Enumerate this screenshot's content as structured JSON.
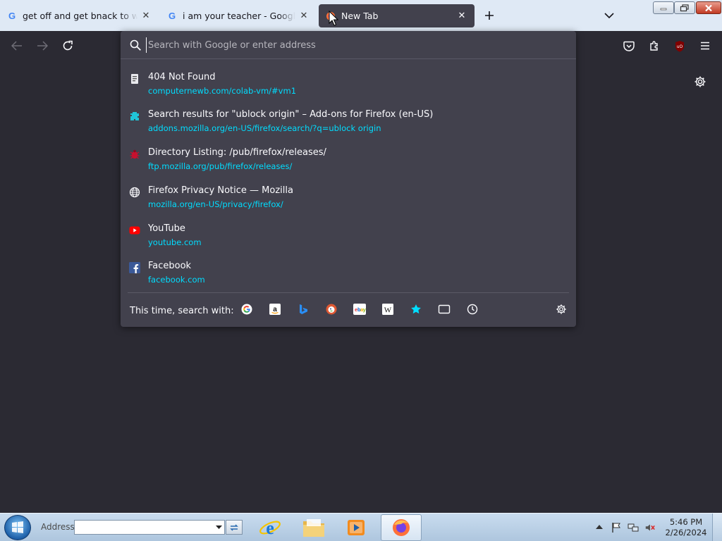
{
  "tabs": [
    {
      "title": "get off and get bnack to work -",
      "favicon": "google-favicon",
      "active": false
    },
    {
      "title": "i am your teacher - Google Sear",
      "favicon": "google-favicon",
      "active": false
    },
    {
      "title": "New Tab",
      "favicon": "firefox-favicon",
      "active": true
    }
  ],
  "urlbar": {
    "placeholder": "Search with Google or enter address",
    "value": ""
  },
  "results": [
    {
      "title": "404 Not Found",
      "url": "computernewb.com/colab-vm/#vm1",
      "icon": "page-favicon"
    },
    {
      "title": "Search results for \"ublock origin\" – Add-ons for Firefox (en-US)",
      "url": "addons.mozilla.org/en-US/firefox/search/?q=ublock origin",
      "icon": "addons-favicon"
    },
    {
      "title": "Directory Listing: /pub/firefox/releases/",
      "url": "ftp.mozilla.org/pub/firefox/releases/",
      "icon": "bug-favicon"
    },
    {
      "title": "Firefox Privacy Notice — Mozilla",
      "url": "mozilla.org/en-US/privacy/firefox/",
      "icon": "globe-icon"
    },
    {
      "title": "YouTube",
      "url": "youtube.com",
      "icon": "youtube-favicon"
    },
    {
      "title": "Facebook",
      "url": "facebook.com",
      "icon": "facebook-favicon"
    }
  ],
  "oneoff": {
    "label": "This time, search with:",
    "engines": [
      "google",
      "amazon",
      "bing",
      "duckduckgo",
      "ebay",
      "wikipedia",
      "bookmarks",
      "tabs",
      "history"
    ]
  },
  "taskbar": {
    "address_label": "Address",
    "address_value": "",
    "clock_time": "5:46 PM",
    "clock_date": "2/26/2024"
  },
  "colors": {
    "accent_url": "#00ddff",
    "panel": "#42414d",
    "toolbar": "#2b2a33"
  }
}
